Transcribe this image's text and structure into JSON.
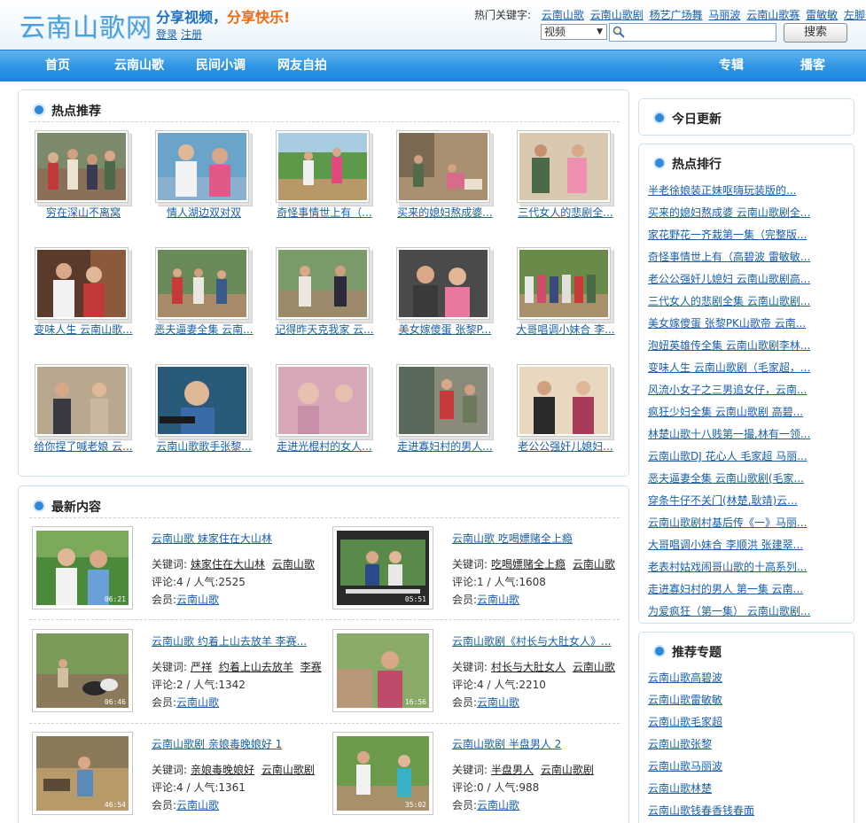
{
  "header": {
    "logo": "云南山歌网",
    "slogan_part1": "分享视频，",
    "slogan_part2": "分享快乐!",
    "login": "登录",
    "register": "注册",
    "hot_keywords_label": "热门关键字:",
    "hot_keywords": [
      "云南山歌",
      "云南山歌剧",
      "杨艺广场舞",
      "马丽波",
      "云南山歌赛",
      "雷敏敏",
      "左脚舞"
    ],
    "search_type": "视频",
    "search_value": "",
    "search_button": "搜索"
  },
  "nav": {
    "left": [
      "首页",
      "云南山歌",
      "民间小调",
      "网友自拍"
    ],
    "right": [
      "专辑",
      "播客"
    ]
  },
  "hot": {
    "title": "热点推荐",
    "items": [
      {
        "caption": "穷在深山不离窝"
      },
      {
        "caption": "情人湖边双对双"
      },
      {
        "caption": "奇怪事情世上有（..."
      },
      {
        "caption": "买来的媳妇熬成婆..."
      },
      {
        "caption": "三代女人的悲剧全..."
      },
      {
        "caption": "变味人生 云南山歌..."
      },
      {
        "caption": "恶夫逼妻全集 云南..."
      },
      {
        "caption": "记得昨天克我家 云..."
      },
      {
        "caption": "美女嫁傻蛋 张黎P..."
      },
      {
        "caption": "大哥唱调小妹合 李..."
      },
      {
        "caption": "给你捏了喊老娘 云..."
      },
      {
        "caption": "云南山歌歌手张黎..."
      },
      {
        "caption": "走进光棍村的女人..."
      },
      {
        "caption": "走进寡妇村的男人..."
      },
      {
        "caption": "老公公强奸儿媳妇..."
      }
    ]
  },
  "latest": {
    "title": "最新内容",
    "keywords_label": "关键词:",
    "member_label": "会员:",
    "items": [
      {
        "title": "云南山歌 妹家住在大山林",
        "keywords": [
          "妹家住在大山林",
          "云南山歌"
        ],
        "stats": "评论:4 / 人气:2525",
        "member": "云南山歌",
        "duration": "06:21"
      },
      {
        "title": "云南山歌 吃喝嫖赌全上瘾",
        "keywords": [
          "吃喝嫖赌全上瘾",
          "云南山歌"
        ],
        "stats": "评论:1 / 人气:1608",
        "member": "云南山歌",
        "duration": "05:51"
      },
      {
        "title": "云南山歌 约着上山去放羊 李赛...",
        "keywords": [
          "严祥",
          "约着上山去放羊",
          "李赛"
        ],
        "stats": "评论:2 / 人气:1342",
        "member": "云南山歌",
        "duration": "06:46"
      },
      {
        "title": "云南山歌剧《村长与大肚女人》...",
        "keywords": [
          "村长与大肚女人",
          "云南山歌"
        ],
        "stats": "评论:4 / 人气:2210",
        "member": "云南山歌",
        "duration": "16:56"
      },
      {
        "title": "云南山歌剧 亲娘毒晚娘好 1",
        "keywords": [
          "亲娘毒晚娘好",
          "云南山歌剧"
        ],
        "stats": "评论:4 / 人气:1361",
        "member": "云南山歌",
        "duration": "46:54"
      },
      {
        "title": "云南山歌剧 半盘男人 2",
        "keywords": [
          "半盘男人",
          "云南山歌剧"
        ],
        "stats": "评论:0 / 人气:988",
        "member": "云南山歌",
        "duration": "35:02"
      }
    ]
  },
  "sidebar": {
    "today_title": "今日更新",
    "rank_title": "热点排行",
    "rank": [
      "半老徐娘装正妹呕嗨玩装版的...",
      "买来的媳妇熬成婆 云南山歌剧全...",
      "家花野花一齐栽第一集（完整版...",
      "奇怪事情世上有（高碧波 雷敏敏...",
      "老公公强奸儿媳妇 云南山歌剧高...",
      "三代女人的悲剧全集 云南山歌剧...",
      "美女嫁傻蛋 张黎PK山歌帝 云南...",
      "泡妞英雄传全集 云南山歌剧李林...",
      "变味人生 云南山歌剧（毛家超，...",
      "风流小女子之三男追女仔，云南...",
      "疯狂少妇全集 云南山歌剧 高碧...",
      "林楚山歌十八贱第一撮,林有一领...",
      "云南山歌DJ 花心人 毛家超 马丽...",
      "恶夫逼妻全集 云南山歌剧(毛家...",
      "穿条牛仔不关门(林楚,耿靖)云...",
      "云南山歌剧村基后传《一》马丽...",
      "大哥唱调小妹合 李顺洪 张建翠...",
      "老表村姑戏闹哥山歌的十高系列...",
      "走进寡妇村的男人 第一集 云南...",
      "为爱疯狂（第一集） 云南山歌剧..."
    ],
    "topic_title": "推荐专题",
    "topics": [
      "云南山歌高碧波",
      "云南山歌雷敏敏",
      "云南山歌毛家超",
      "云南山歌张黎",
      "云南山歌马丽波",
      "云南山歌林楚",
      "云南山歌钱春香钱春面"
    ]
  },
  "colors": {
    "link": "#1a5fa8",
    "nav_blue": "#2d94e3",
    "border": "#cfe1ef",
    "accent_orange": "#f06a0f"
  }
}
